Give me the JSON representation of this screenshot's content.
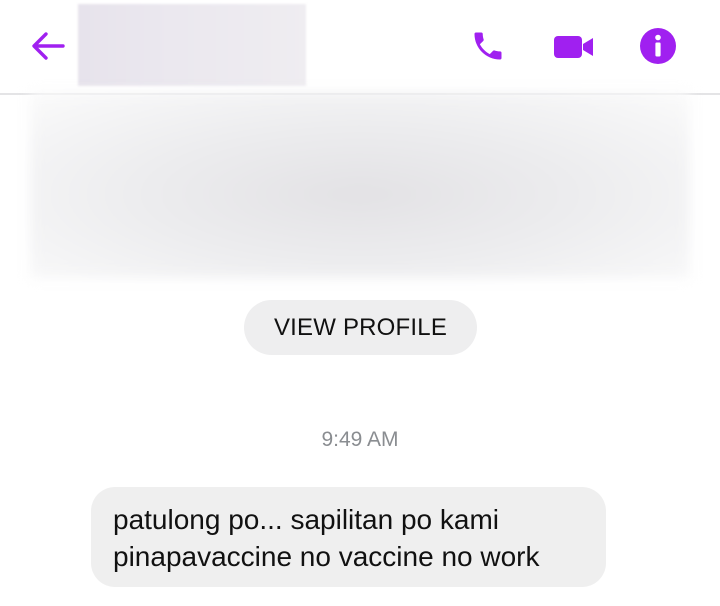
{
  "header": {
    "back_icon": "arrow-left-icon",
    "call_icon": "phone-icon",
    "video_icon": "video-camera-icon",
    "info_icon": "info-icon",
    "accent_color": "#a020f0"
  },
  "profile": {
    "view_profile_label": "VIEW PROFILE"
  },
  "conversation": {
    "timestamp": "9:49 AM",
    "messages": [
      {
        "direction": "incoming",
        "text": "patulong po... sapilitan po kami\npinapavaccine no vaccine no work"
      }
    ]
  }
}
